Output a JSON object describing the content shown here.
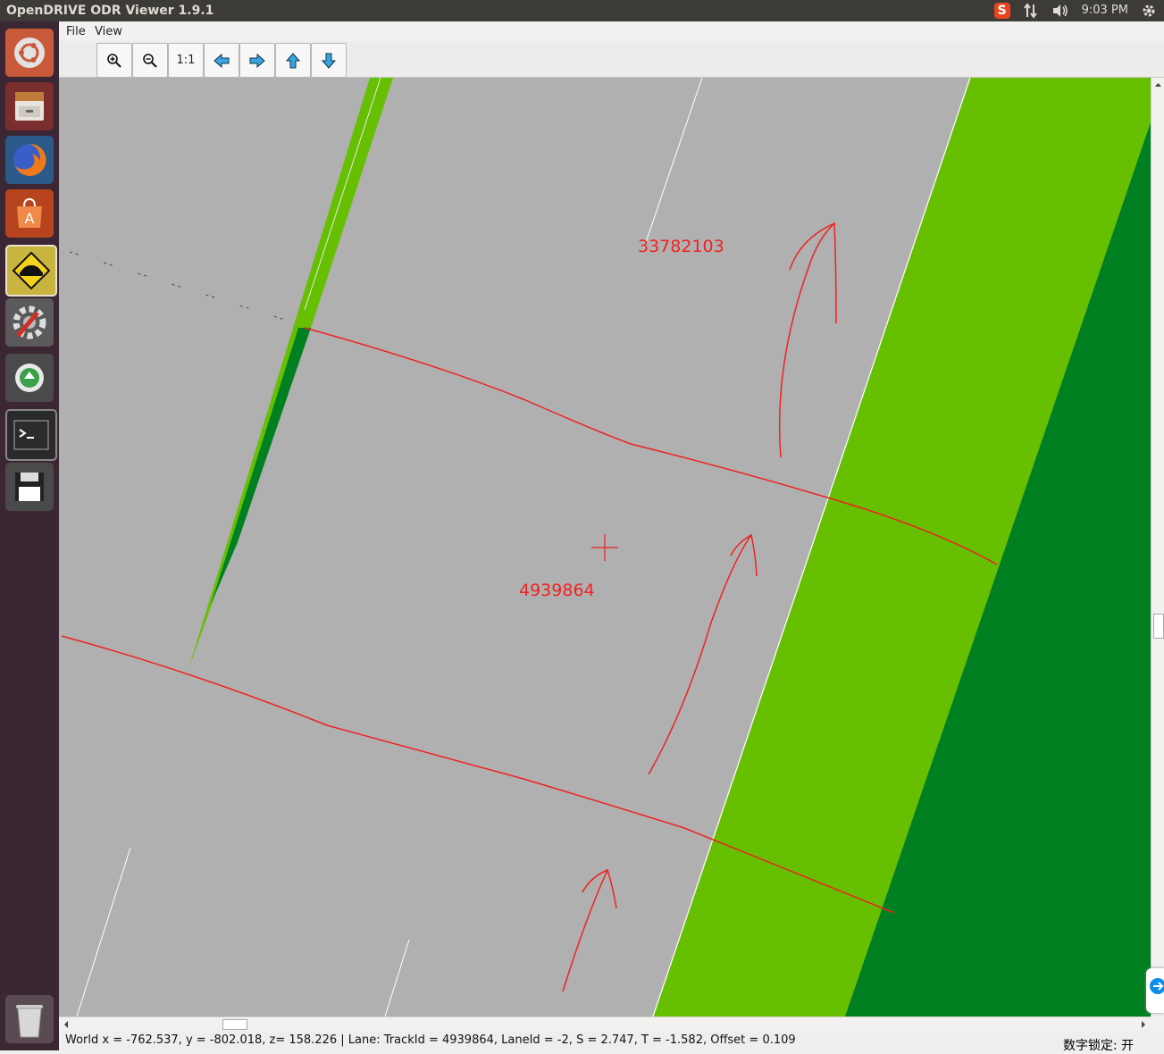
{
  "app": {
    "title": "OpenDRIVE ODR Viewer 1.9.1"
  },
  "topbar": {
    "clock": "9:03 PM",
    "ime_icon_label": "S"
  },
  "menu": {
    "file": "File",
    "view": "View"
  },
  "toolbar": {
    "actual_size_label": "1:1"
  },
  "map": {
    "road_label_upper": "33782103",
    "road_label_center": "4939864",
    "colors": {
      "asphalt": "#b0b0b0",
      "grass": "#66bf00",
      "dark_green": "#008020",
      "annotation": "#ee2222"
    }
  },
  "status": {
    "text": "World x = -762.537, y = -802.018, z= 158.226 | Lane: TrackId = 4939864, LaneId = -2, S = 2.747, T = -1.582, Offset = 0.109"
  },
  "ime_text": "数字锁定: 开"
}
